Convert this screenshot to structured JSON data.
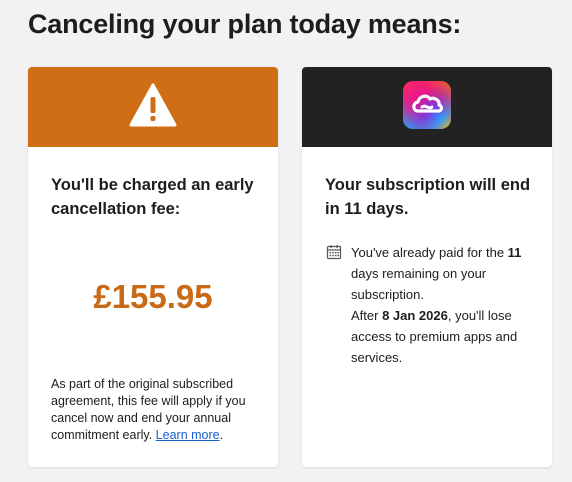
{
  "page": {
    "title": "Canceling your plan today means:"
  },
  "fee_card": {
    "icon": "warning-icon",
    "header_color": "#cf6e14",
    "heading": "You'll be charged an early cancellation fee:",
    "amount": "£155.95",
    "amount_color": "#c86a16",
    "note": "As part of the original subscribed agreement, this fee will apply if you cancel now and end your annual commitment early.",
    "link_label": "Learn more",
    "link_suffix": "."
  },
  "subscription_card": {
    "icon": "creative-cloud-icon",
    "header_color": "#222222",
    "heading": "Your subscription will end in 11 days.",
    "detail": {
      "icon": "calendar-icon",
      "line1_prefix": "You've already paid for the ",
      "line1_days": "11",
      "line1_suffix": " days remaining on your subscription.",
      "line2_prefix": "After ",
      "line2_date": "8 Jan 2026",
      "line2_suffix": ", you'll lose access to premium apps and services."
    }
  }
}
